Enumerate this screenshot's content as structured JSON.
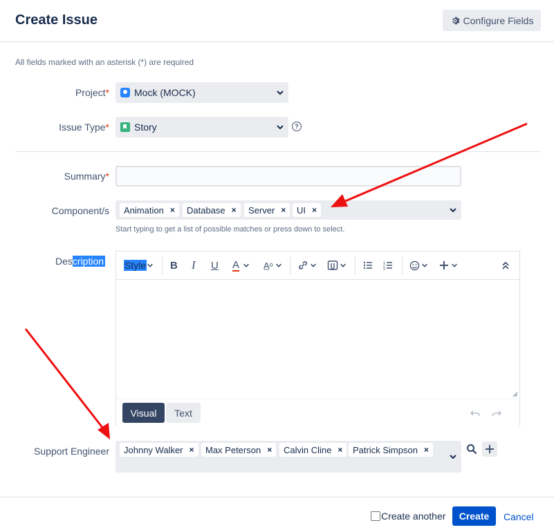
{
  "header": {
    "title": "Create Issue",
    "configure_label": "Configure Fields"
  },
  "required_note": "All fields marked with an asterisk (*) are required",
  "project": {
    "label": "Project",
    "asterisk": "*",
    "value": "Mock (MOCK)"
  },
  "issue_type": {
    "label": "Issue Type",
    "asterisk": "*",
    "value": "Story"
  },
  "summary": {
    "label": "Summary",
    "asterisk": "*",
    "value": ""
  },
  "components": {
    "label": "Component/s",
    "chips": [
      "Animation",
      "Database",
      "Server",
      "UI"
    ],
    "hint": "Start typing to get a list of possible matches or press down to select."
  },
  "description": {
    "label_plain": "Des",
    "label_highlighted": "cription",
    "style_label": "Style",
    "mode_visual": "Visual",
    "mode_text": "Text"
  },
  "support_engineer": {
    "label": "Support Engineer",
    "chips": [
      "Johnny Walker",
      "Max Peterson",
      "Calvin Cline",
      "Patrick Simpson"
    ]
  },
  "footer": {
    "create_another": "Create another",
    "create": "Create",
    "cancel": "Cancel"
  },
  "colors": {
    "primary": "#0052cc",
    "required": "#de350b",
    "annotation_arrow": "#ee1111",
    "selection": "#2684ff"
  }
}
